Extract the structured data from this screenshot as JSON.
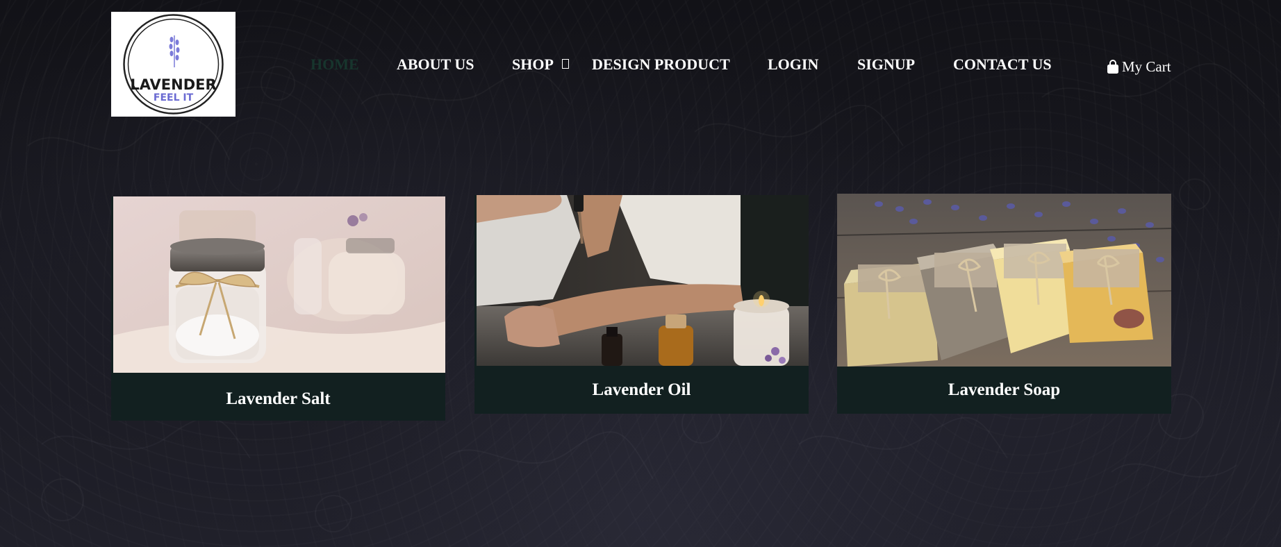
{
  "site": {
    "logo": {
      "title": "LAVENDER",
      "tagline": "FEEL IT"
    }
  },
  "nav": {
    "items": [
      {
        "label": "HOME",
        "active": true
      },
      {
        "label": "ABOUT US",
        "active": false
      },
      {
        "label": "SHOP",
        "active": false
      },
      {
        "label": "DESIGN PRODUCT",
        "active": false
      },
      {
        "label": "LOGIN",
        "active": false
      },
      {
        "label": "SIGNUP",
        "active": false
      },
      {
        "label": "CONTACT US",
        "active": false
      }
    ]
  },
  "cart": {
    "label": "My Cart",
    "icon": "shopping-bag-icon"
  },
  "products": [
    {
      "name": "Lavender Salt",
      "image": "salt-jar-photo"
    },
    {
      "name": "Lavender Oil",
      "image": "oil-bottles-photo"
    },
    {
      "name": "Lavender Soap",
      "image": "soap-bars-photo"
    }
  ],
  "colors": {
    "background": "#17171d",
    "card_caption_bg": "#122020",
    "nav_text": "#ffffff",
    "nav_active": "#17352d",
    "logo_accent": "#6a6ad2"
  }
}
